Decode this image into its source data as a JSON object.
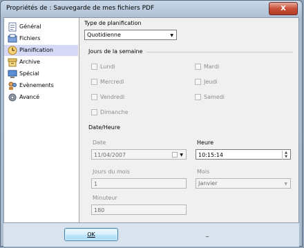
{
  "window": {
    "title": "Propriétés de : Sauvegarde de mes fichiers PDF",
    "close_label": "X"
  },
  "sidebar": {
    "items": [
      {
        "label": "Général",
        "icon": "general-icon"
      },
      {
        "label": "Fichiers",
        "icon": "files-icon"
      },
      {
        "label": "Planification",
        "icon": "schedule-icon",
        "selected": true
      },
      {
        "label": "Archive",
        "icon": "archive-icon"
      },
      {
        "label": "Spécial",
        "icon": "special-icon"
      },
      {
        "label": "Evènements",
        "icon": "events-icon"
      },
      {
        "label": "Avancé",
        "icon": "advanced-icon"
      }
    ]
  },
  "schedule": {
    "type_label": "Type de planification",
    "type_value": "Quotidienne",
    "days_group": "Jours de la semaine",
    "days": {
      "lundi": "Lundi",
      "mardi": "Mardi",
      "mercredi": "Mercredi",
      "jeudi": "Jeudi",
      "vendredi": "Vendredi",
      "samedi": "Samedi",
      "dimanche": "Dimanche"
    },
    "datetime_group": "Date/Heure",
    "date_label": "Date",
    "date_value": "11/04/2007",
    "time_label": "Heure",
    "time_value": "10:15:14",
    "days_of_month_label": "Jours du mois",
    "days_of_month_value": "1",
    "month_label": "Mois",
    "month_value": "Janvier",
    "timer_label": "Minuteur",
    "timer_value": "180"
  },
  "footer": {
    "ok_label": "OK",
    "cancel_label": "_"
  }
}
